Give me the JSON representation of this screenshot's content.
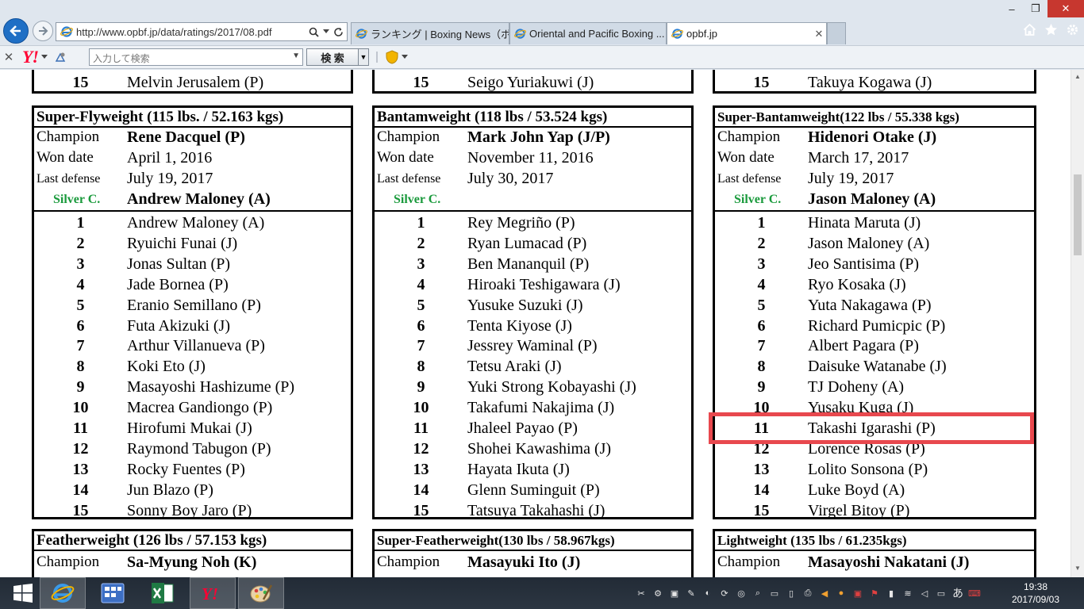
{
  "browser": {
    "address": "http://www.opbf.jp/data/ratings/2017/08.pdf",
    "tabs": [
      {
        "label": "ランキング | Boxing News（ボ..."
      },
      {
        "label": "Oriental and Pacific Boxing ..."
      },
      {
        "label": "opbf.jp"
      }
    ],
    "window_controls": {
      "minimize": "–",
      "maximize": "❐",
      "close": "✕"
    }
  },
  "toolbar": {
    "close_glyph": "✕",
    "yahoo_logo": "Y!",
    "search_placeholder": "入力して検索",
    "search_button": "検 索"
  },
  "prev_rows": [
    {
      "num": "15",
      "name": "Melvin Jerusalem (P)"
    },
    {
      "num": "15",
      "name": "Seigo Yuriakuwi (J)"
    },
    {
      "num": "15",
      "name": "Takuya Kogawa (J)"
    }
  ],
  "divisions": [
    {
      "title": "Super-Flyweight (115 lbs. / 52.163 kgs)",
      "champion_label": "Champion",
      "champion": "Rene Dacquel (P)",
      "won_label": "Won date",
      "won_date": "April 1, 2016",
      "last_label": "Last defense",
      "last_defense": "July 19, 2017",
      "silver_label": "Silver C.",
      "silver": "Andrew Maloney (A)",
      "ranks": [
        {
          "num": "1",
          "name": "Andrew Maloney (A)"
        },
        {
          "num": "2",
          "name": "Ryuichi Funai (J)"
        },
        {
          "num": "3",
          "name": "Jonas Sultan (P)"
        },
        {
          "num": "4",
          "name": "Jade Bornea (P)"
        },
        {
          "num": "5",
          "name": "Eranio Semillano (P)"
        },
        {
          "num": "6",
          "name": "Futa Akizuki (J)"
        },
        {
          "num": "7",
          "name": "Arthur Villanueva (P)"
        },
        {
          "num": "8",
          "name": "Koki Eto (J)"
        },
        {
          "num": "9",
          "name": "Masayoshi Hashizume (P)"
        },
        {
          "num": "10",
          "name": "Macrea Gandiongo (P)"
        },
        {
          "num": "11",
          "name": "Hirofumi Mukai (J)"
        },
        {
          "num": "12",
          "name": "Raymond Tabugon (P)"
        },
        {
          "num": "13",
          "name": "Rocky Fuentes (P)"
        },
        {
          "num": "14",
          "name": "Jun Blazo (P)"
        },
        {
          "num": "15",
          "name": "Sonny Boy Jaro (P)"
        }
      ]
    },
    {
      "title": "Bantamweight (118 lbs / 53.524 kgs)",
      "champion_label": "Champion",
      "champion": "Mark John Yap (J/P)",
      "won_label": "Won date",
      "won_date": "November 11, 2016",
      "last_label": "Last defense",
      "last_defense": "July 30, 2017",
      "silver_label": "Silver C.",
      "silver": "",
      "ranks": [
        {
          "num": "1",
          "name": "Rey Megriño (P)"
        },
        {
          "num": "2",
          "name": "Ryan Lumacad (P)"
        },
        {
          "num": "3",
          "name": "Ben Mananquil (P)"
        },
        {
          "num": "4",
          "name": "Hiroaki Teshigawara (J)"
        },
        {
          "num": "5",
          "name": "Yusuke Suzuki (J)"
        },
        {
          "num": "6",
          "name": "Tenta Kiyose (J)"
        },
        {
          "num": "7",
          "name": "Jessrey Waminal (P)"
        },
        {
          "num": "8",
          "name": "Tetsu Araki (J)"
        },
        {
          "num": "9",
          "name": "Yuki Strong Kobayashi (J)"
        },
        {
          "num": "10",
          "name": "Takafumi Nakajima (J)"
        },
        {
          "num": "11",
          "name": "Jhaleel Payao (P)"
        },
        {
          "num": "12",
          "name": "Shohei Kawashima (J)"
        },
        {
          "num": "13",
          "name": "Hayata Ikuta (J)"
        },
        {
          "num": "14",
          "name": "Glenn Suminguit (P)"
        },
        {
          "num": "15",
          "name": "Tatsuya Takahashi (J)"
        }
      ]
    },
    {
      "title": "Super-Bantamweight(122 lbs / 55.338 kgs)",
      "champion_label": "Champion",
      "champion": "Hidenori Otake (J)",
      "won_label": "Won date",
      "won_date": "March 17, 2017",
      "last_label": "Last defense",
      "last_defense": "July 19, 2017",
      "silver_label": "Silver C.",
      "silver": "Jason Maloney (A)",
      "ranks": [
        {
          "num": "1",
          "name": "Hinata Maruta (J)"
        },
        {
          "num": "2",
          "name": "Jason Maloney (A)"
        },
        {
          "num": "3",
          "name": "Jeo Santisima (P)"
        },
        {
          "num": "4",
          "name": "Ryo Kosaka (J)"
        },
        {
          "num": "5",
          "name": "Yuta Nakagawa (P)"
        },
        {
          "num": "6",
          "name": "Richard Pumicpic (P)"
        },
        {
          "num": "7",
          "name": "Albert Pagara (P)"
        },
        {
          "num": "8",
          "name": "Daisuke Watanabe (J)"
        },
        {
          "num": "9",
          "name": "TJ Doheny (A)"
        },
        {
          "num": "10",
          "name": "Yusaku Kuga (J)"
        },
        {
          "num": "11",
          "name": "Takashi Igarashi (P)"
        },
        {
          "num": "12",
          "name": "Lorence Rosas (P)"
        },
        {
          "num": "13",
          "name": "Lolito Sonsona (P)"
        },
        {
          "num": "14",
          "name": "Luke Boyd (A)"
        },
        {
          "num": "15",
          "name": "Virgel Bitoy (P)"
        }
      ]
    }
  ],
  "next_divisions": [
    {
      "title": "Featherweight (126 lbs / 57.153 kgs)",
      "champion_label": "Champion",
      "champion": "Sa-Myung Noh (K)"
    },
    {
      "title": "Super-Featherweight(130 lbs / 58.967kgs)",
      "champion_label": "Champion",
      "champion": "Masayuki Ito (J)"
    },
    {
      "title": "Lightweight (135 lbs / 61.235kgs)",
      "champion_label": "Champion",
      "champion": "Masayoshi Nakatani (J)"
    }
  ],
  "taskbar": {
    "clock_time": "19:38",
    "clock_date": "2017/09/03",
    "ime": "あ"
  }
}
